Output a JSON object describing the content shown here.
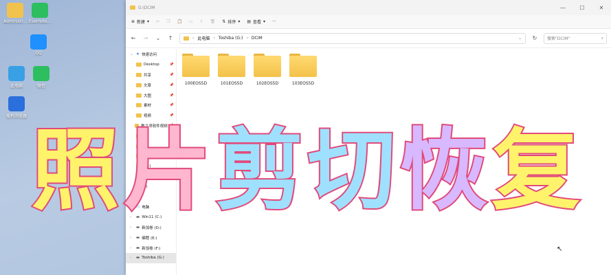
{
  "desktop": {
    "icons": [
      {
        "label": "Administr...",
        "color": "#f2c24e"
      },
      {
        "label": "Evernote...",
        "color": "#2dbe60"
      },
      {
        "label": "QQ",
        "color": "#1e90ff"
      },
      {
        "label": "此电脑",
        "color": "#39a0e6"
      },
      {
        "label": "微信",
        "color": "#2dbe60"
      },
      {
        "label": "搜狗浏览器",
        "color": "#2a6fdb"
      }
    ]
  },
  "window": {
    "title": "G:\\DCIM",
    "toolbar": {
      "new_label": "新建",
      "sort_label": "排序",
      "view_label": "查看",
      "more_label": "···"
    },
    "address": {
      "parts": [
        "此电脑",
        "Toshiba (G:)",
        "DCIM"
      ],
      "search_placeholder": "搜索\"DCIM\""
    },
    "nav": {
      "quick_access": "快速访问",
      "items": [
        {
          "label": "Desktop",
          "pinned": true
        },
        {
          "label": "共享",
          "pinned": true
        },
        {
          "label": "文章",
          "pinned": true
        },
        {
          "label": "大图",
          "pinned": true
        },
        {
          "label": "素材",
          "pinned": true
        },
        {
          "label": "视频",
          "pinned": true
        },
        {
          "label": "数之寻软件视频",
          "pinned": true
        },
        {
          "label": "",
          "pinned": true
        },
        {
          "label": "",
          "pinned": false
        },
        {
          "label": "",
          "pinned": false
        },
        {
          "label": "(G:)",
          "pinned": false
        },
        {
          "label": "",
          "pinned": false
        },
        {
          "label": "J:)",
          "pinned": false
        },
        {
          "label": "",
          "pinned": false
        }
      ],
      "this_pc": "电脑",
      "drives": [
        {
          "label": "Win11 (C:)"
        },
        {
          "label": "新加卷 (D:)"
        },
        {
          "label": "编程 (E:)"
        },
        {
          "label": "新加卷 (F:)"
        },
        {
          "label": "Toshiba (G:)",
          "selected": true
        }
      ]
    },
    "folders": [
      "100EOS5D",
      "101EOS5D",
      "102EOS5D",
      "103EOS5D"
    ]
  },
  "overlay": {
    "chars": [
      {
        "ch": "照",
        "color": "#fff36b"
      },
      {
        "ch": "片",
        "color": "#ffb6cf"
      },
      {
        "ch": "剪",
        "color": "#9fe0ff"
      },
      {
        "ch": "切",
        "color": "#9fe0ff"
      },
      {
        "ch": "恢",
        "color": "#d8b8ff"
      },
      {
        "ch": "复",
        "color": "#fff36b"
      }
    ]
  }
}
